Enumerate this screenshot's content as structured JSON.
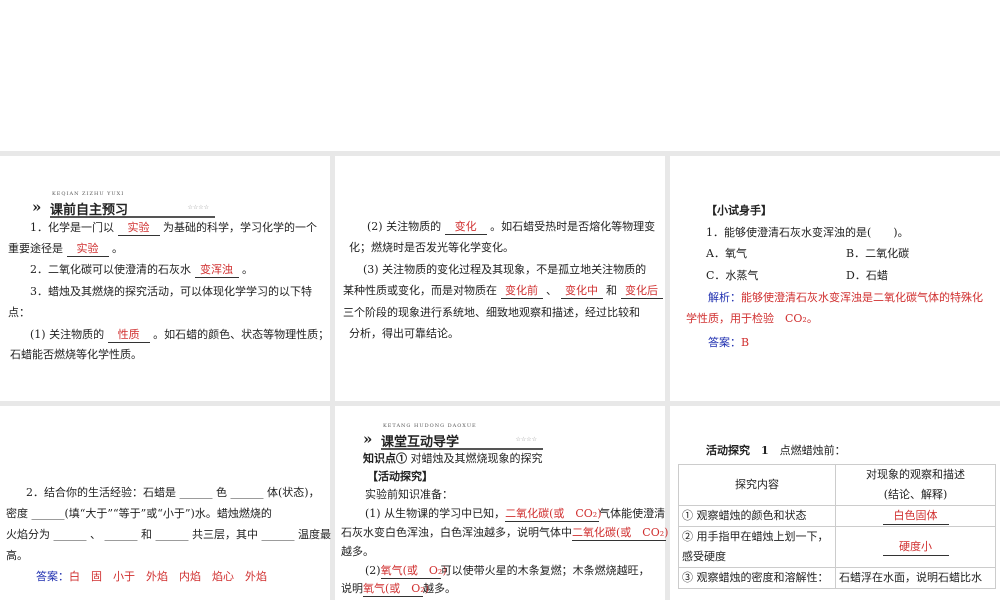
{
  "p1": {
    "header": "课前自主预习",
    "header_pinyin": "KEQIAN ZIZHU YUXI",
    "stars": "☆☆☆☆",
    "q1a": "1．化学是一门以",
    "q1_ans1": "实验",
    "q1b": "为基础的科学，学习化学的一个",
    "q1c": "重要途径是",
    "q1_ans2": "实验",
    "q1d": "。",
    "q2a": "2．二氧化碳可以使澄清的石灰水",
    "q2_ans": "变浑浊",
    "q2b": "。",
    "q3a": "3．蜡烛及其燃烧的探究活动，可以体现化学学习的以下特",
    "q3b": "点：",
    "q3_1a": "(1) 关注物质的",
    "q3_1ans": "性质",
    "q3_1b": "。如石蜡的颜色、状态等物理性质；",
    "q3_1c": "石蜡能否燃烧等化学性质。"
  },
  "p2": {
    "l1a": "(2) 关注物质的",
    "l1ans": "变化",
    "l1b": "。如石蜡受热时是否熔化等物理变",
    "l2": "化；燃烧时是否发光等化学变化。",
    "l3": "(3) 关注物质的变化过程及其现象，不是孤立地关注物质的",
    "l4a": "某种性质或变化，而是对物质在",
    "ans1": "变化前",
    "sep1": "、",
    "ans2": "变化中",
    "sep2": "和",
    "ans3": "变化后",
    "l5": "三个阶段的现象进行系统地、细致地观察和描述，经过比较和",
    "l6": "分析，得出可靠结论。"
  },
  "p3": {
    "title": "【小试身手】",
    "q": "1．能够使澄清石灰水变浑浊的是(　　)。",
    "A": "A．氧气",
    "B": "B．二氧化碳",
    "C": "C．水蒸气",
    "D": "D．石蜡",
    "jx_label": "解析：",
    "jx1": "能够使澄清石灰水变浑浊是二氧化碳气体的特殊化",
    "jx2": "学性质，用于检验　CO₂。",
    "ans_label": "答案：",
    "ans": "B"
  },
  "p4": {
    "l1": "2．结合你的生活经验：石蜡是 ______ 色 ______ 体(状态)，",
    "l2": "密度 ______(填“大于”“等于”或“小于”)水。蜡烛燃烧的",
    "l3": "火焰分为 ______ 、 ______ 和 ______ 共三层，其中 ______ 温度最",
    "l4": "高。",
    "ans_label": "答案：",
    "ans": "白　固　小于　外焰　内焰　焰心　外焰"
  },
  "p5": {
    "header": "课堂互动导学",
    "header_pinyin": "KETANG HUDONG DAOXUE",
    "stars": "☆☆☆☆",
    "kp_label": "知识点①",
    "kp": "对蜡烛及其燃烧现象的探究",
    "act": "【活动探究】",
    "prep": "实验前知识准备：",
    "l1a": "(1) 从生物课的学习中已知，",
    "ans1": "二氧化碳(或　CO₂)",
    "l1b": "气体能使澄清",
    "l2a": "石灰水变白色浑浊，白色浑浊越多，说明气体中",
    "ans2": "二氧化碳(或　CO₂)",
    "l3": "越多。",
    "l4a": "(2)",
    "ans3": "氧气(或　O₂)",
    "l4b": "可以使带火星的木条复燃；木条燃烧越旺，",
    "l5a": "说明",
    "ans4": "氧气(或　O₂)",
    "l5b": "越多。"
  },
  "p6": {
    "title_bold": "活动探究　1",
    "title": "点燃蜡烛前：",
    "th1": "探究内容",
    "th2a": "对现象的观察和描述",
    "th2b": "(结论、解释)",
    "rows": [
      {
        "c": "① 观察蜡烛的颜色和状态",
        "a": "白色固体"
      },
      {
        "c1": "② 用手指甲在蜡烛上划一下，",
        "c2": "感受硬度",
        "a": "硬度小"
      },
      {
        "c": "③ 观察蜡烛的密度和溶解性：",
        "t": "石蜡浮在水面，说明石蜡比水"
      }
    ]
  }
}
